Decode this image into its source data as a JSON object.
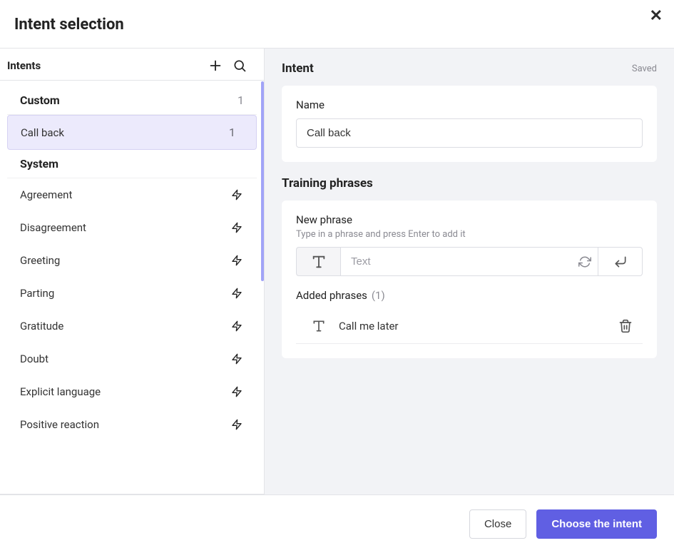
{
  "header": {
    "title": "Intent selection"
  },
  "sidebar": {
    "title": "Intents",
    "groups": [
      {
        "name": "Custom",
        "count": "1",
        "items": [
          {
            "label": "Call back",
            "count": "1",
            "selected": true
          }
        ]
      },
      {
        "name": "System",
        "items": [
          {
            "label": "Agreement"
          },
          {
            "label": "Disagreement"
          },
          {
            "label": "Greeting"
          },
          {
            "label": "Parting"
          },
          {
            "label": "Gratitude"
          },
          {
            "label": "Doubt"
          },
          {
            "label": "Explicit language"
          },
          {
            "label": "Positive reaction"
          }
        ]
      }
    ]
  },
  "main": {
    "title": "Intent",
    "saved_label": "Saved",
    "name_label": "Name",
    "name_value": "Call back",
    "training_phrases_label": "Training phrases",
    "new_phrase_label": "New phrase",
    "new_phrase_hint": "Type in a phrase and press Enter to add it",
    "phrase_placeholder": "Text",
    "added_label": "Added phrases",
    "added_count_display": "(1)",
    "added_phrases": [
      {
        "type": "text",
        "text": "Call me later"
      }
    ]
  },
  "footer": {
    "close_label": "Close",
    "choose_label": "Choose the intent"
  }
}
